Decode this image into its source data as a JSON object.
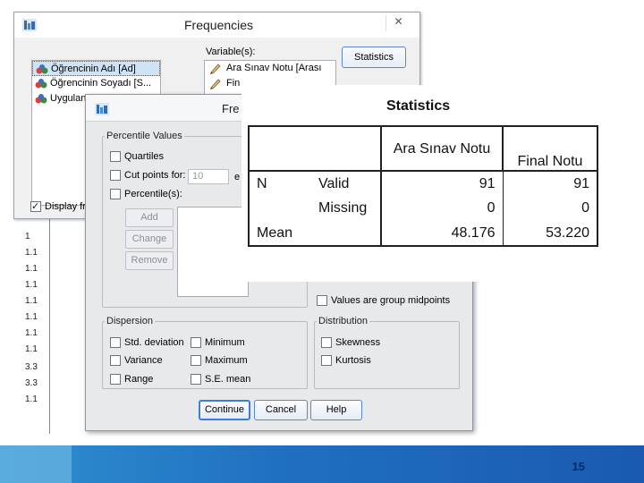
{
  "slide": {
    "page_number": "15"
  },
  "background_column": [
    "1",
    "1.1",
    "1.1",
    "1.1",
    "1.1",
    "1.1",
    "1.1",
    "1.1",
    "3.3",
    "3.3",
    "1.1"
  ],
  "frequencies_dialog": {
    "title": "Frequencies",
    "close_icon": "close-icon",
    "source_variables": [
      {
        "label": "Öğrencinin Adı [Ad]",
        "selected": true
      },
      {
        "label": "Öğrencinin Soyadı [S...",
        "selected": false
      },
      {
        "label": "Uygulan",
        "selected": false
      }
    ],
    "variables_label": "Variable(s):",
    "variables": [
      "Ara Sınav Notu [Arası",
      "Fin"
    ],
    "statistics_button": "Statistics",
    "display_tables_label": "Display fr"
  },
  "statistics_dialog": {
    "title": "Fre",
    "percentile_values": {
      "legend": "Percentile Values",
      "quartiles": "Quartiles",
      "cut_points": "Cut points for:",
      "cut_points_value": "10",
      "cut_points_suffix": "e",
      "percentiles": "Percentile(s):",
      "add": "Add",
      "change": "Change",
      "remove": "Remove"
    },
    "values_group_midpoints": "Values are group midpoints",
    "dispersion": {
      "legend": "Dispersion",
      "std_deviation": "Std. deviation",
      "minimum": "Minimum",
      "variance": "Variance",
      "maximum": "Maximum",
      "range": "Range",
      "se_mean": "S.E. mean"
    },
    "distribution": {
      "legend": "Distribution",
      "skewness": "Skewness",
      "kurtosis": "Kurtosis"
    },
    "buttons": {
      "continue": "Continue",
      "cancel": "Cancel",
      "help": "Help"
    }
  },
  "statistics_output": {
    "title": "Statistics",
    "columns": [
      "Ara Sınav Notu",
      "Final Notu"
    ],
    "rows": [
      {
        "label": "N",
        "sublabel": "Valid",
        "values": [
          "91",
          "91"
        ]
      },
      {
        "label": "",
        "sublabel": "Missing",
        "values": [
          "0",
          "0"
        ]
      },
      {
        "label": "Mean",
        "sublabel": "",
        "values": [
          "48.176",
          "53.220"
        ]
      }
    ]
  }
}
